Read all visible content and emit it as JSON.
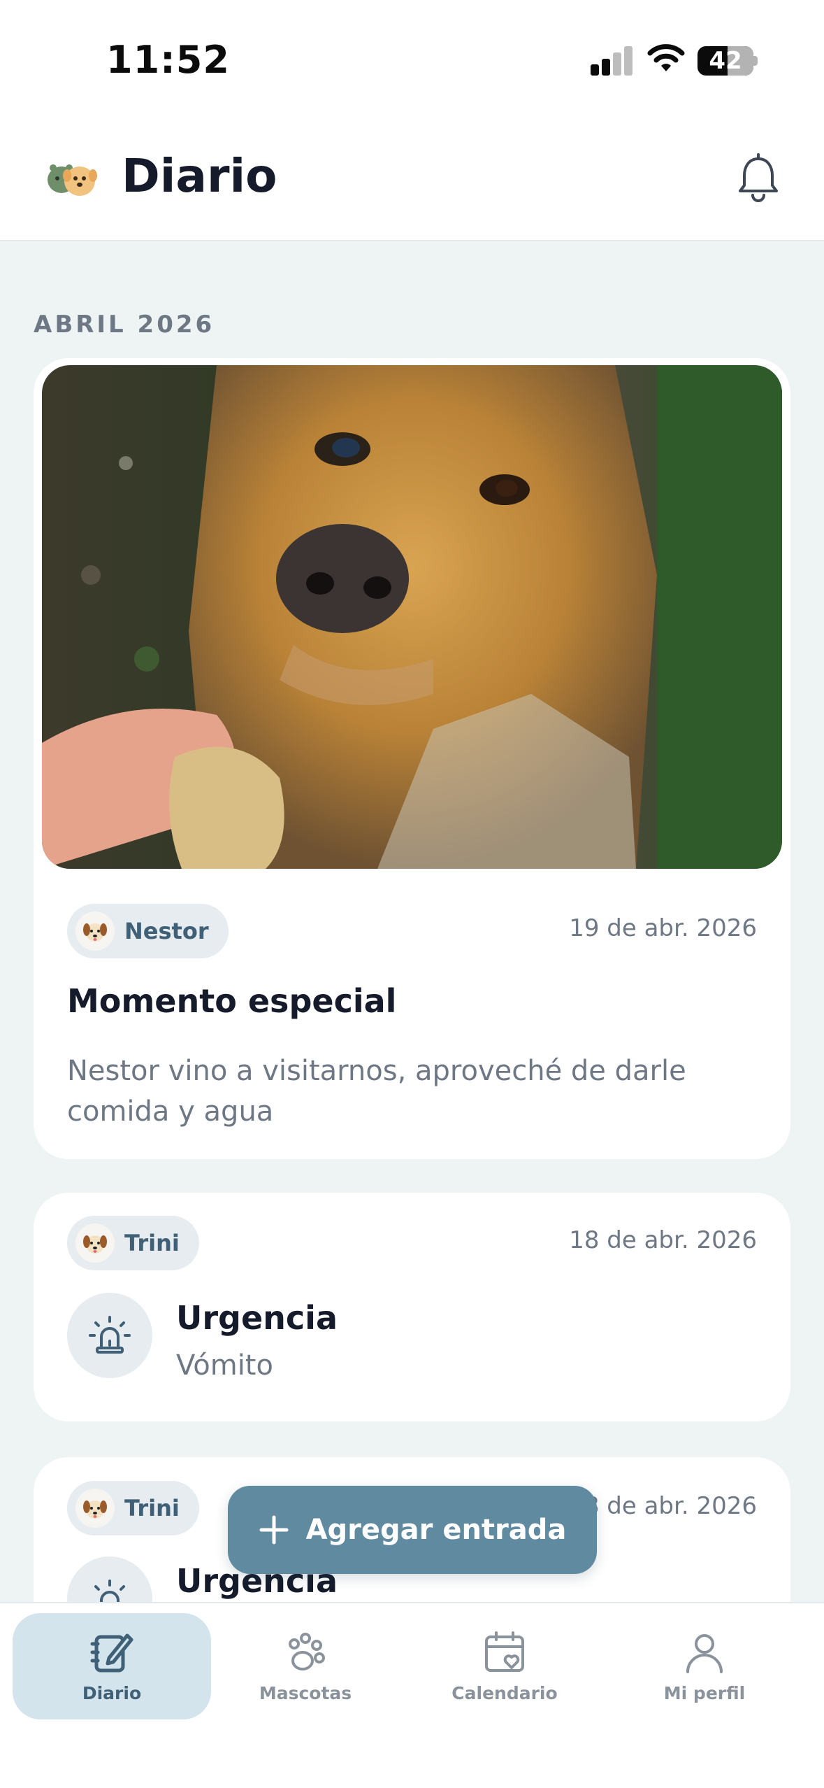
{
  "status_bar": {
    "time": "11:52",
    "battery_level": "42",
    "battery_fraction": 0.42
  },
  "header": {
    "title": "Diario",
    "logo_icon": "pets-logo-icon",
    "bell_icon": "bell-icon"
  },
  "month_section": {
    "label": "ABRIL 2026"
  },
  "entries": [
    {
      "pet_name": "Nestor",
      "date": "19 de abr. 2026",
      "title": "Momento especial",
      "body": "Nestor vino a visitarnos, aproveché de darle comida y agua"
    },
    {
      "pet_name": "Trini",
      "date": "18 de abr. 2026",
      "type_icon": "siren-icon",
      "title": "Urgencia",
      "subtitle": "Vómito"
    },
    {
      "pet_name": "Trini",
      "date": "18 de abr. 2026",
      "type_icon": "siren-icon",
      "title": "Urgencia"
    }
  ],
  "fab": {
    "label": "Agregar entrada",
    "icon": "plus-icon"
  },
  "tabbar": {
    "items": [
      {
        "label": "Diario",
        "icon": "journal-icon",
        "active": true
      },
      {
        "label": "Mascotas",
        "icon": "paw-icon",
        "active": false
      },
      {
        "label": "Calendario",
        "icon": "calendar-heart-icon",
        "active": false
      },
      {
        "label": "Mi perfil",
        "icon": "user-icon",
        "active": false
      }
    ]
  },
  "colors": {
    "accent": "#5f8aa0",
    "active_tab_bg": "#d3e4ec",
    "chip_bg": "#e6ecef",
    "page_bg": "#eef3f4",
    "title_text": "#151b2b",
    "muted_text": "#6e7784"
  }
}
